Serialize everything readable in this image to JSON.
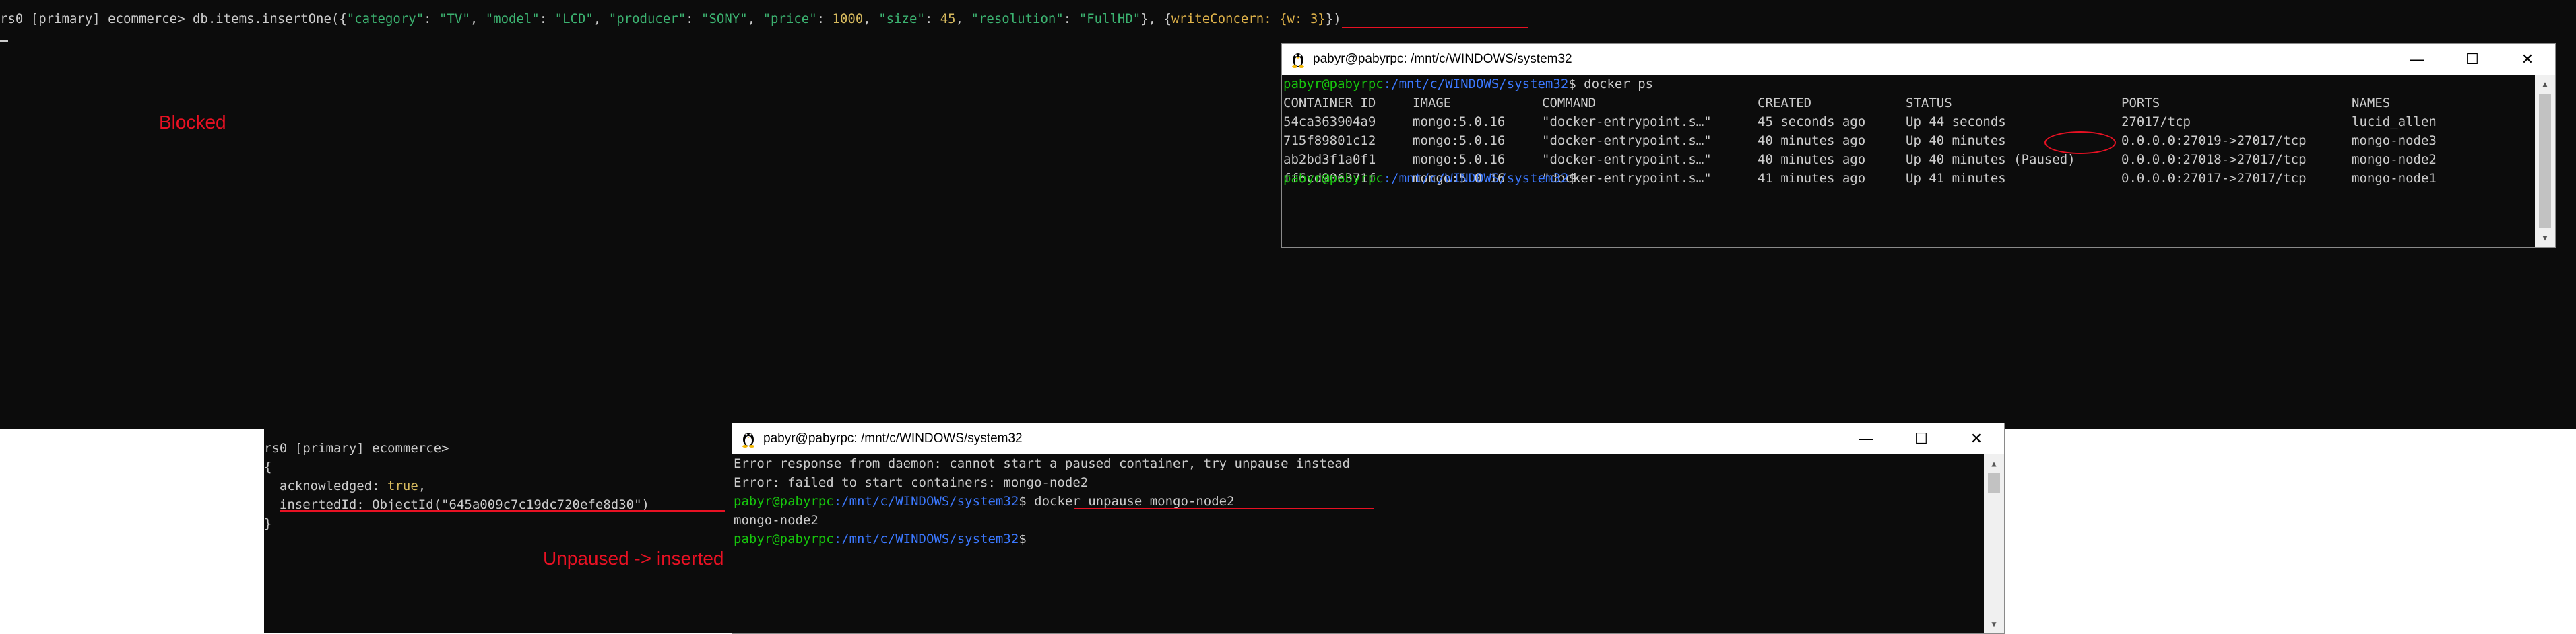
{
  "mongo_shell": {
    "prompt": "rs0 [primary] ecommerce>",
    "cmd_prefix": " db.items.insertOne({",
    "kv": [
      {
        "k": "\"category\"",
        "v": "\"TV\"",
        "num": false
      },
      {
        "k": "\"model\"",
        "v": "\"LCD\"",
        "num": false
      },
      {
        "k": "\"producer\"",
        "v": "\"SONY\"",
        "num": false
      },
      {
        "k": "\"price\"",
        "v": "1000",
        "num": true
      },
      {
        "k": "\"size\"",
        "v": "45",
        "num": true
      },
      {
        "k": "\"resolution\"",
        "v": "\"FullHD\"",
        "num": false
      }
    ],
    "cmd_mid": "}, {",
    "write_concern": "writeConcern: {w: 3}",
    "cmd_end": "})",
    "result_prompt": "rs0 [primary] ecommerce>",
    "result_lines": [
      "{",
      "  acknowledged: ",
      "true",
      ",",
      "  insertedId: ObjectId(\"645a009c7c19dc720efe8d30\")",
      "}"
    ]
  },
  "annotations": {
    "blocked": "Blocked",
    "unpaused": "Unpaused -> inserted"
  },
  "docker_ps_window": {
    "title": "pabyr@pabyrpc: /mnt/c/WINDOWS/system32",
    "prompt_user": "pabyr@pabyrpc",
    "prompt_path": ":/mnt/c/WINDOWS/system32",
    "command": "$ docker ps",
    "headers": [
      "CONTAINER ID",
      "IMAGE",
      "COMMAND",
      "CREATED",
      "STATUS",
      "PORTS",
      "NAMES"
    ],
    "rows": [
      [
        "54ca363904a9",
        "mongo:5.0.16",
        "\"docker-entrypoint.s…\"",
        "45 seconds ago",
        "Up 44 seconds",
        "27017/tcp",
        "lucid_allen"
      ],
      [
        "715f89801c12",
        "mongo:5.0.16",
        "\"docker-entrypoint.s…\"",
        "40 minutes ago",
        "Up 40 minutes",
        "0.0.0.0:27019->27017/tcp",
        "mongo-node3"
      ],
      [
        "ab2bd3f1a0f1",
        "mongo:5.0.16",
        "\"docker-entrypoint.s…\"",
        "40 minutes ago",
        "Up 40 minutes (Paused)",
        "0.0.0.0:27018->27017/tcp",
        "mongo-node2"
      ],
      [
        "ff6cd906371f",
        "mongo:5.0.16",
        "\"docker-entrypoint.s…\"",
        "41 minutes ago",
        "Up 41 minutes",
        "0.0.0.0:27017->27017/tcp",
        "mongo-node1"
      ]
    ],
    "end_prompt": "$"
  },
  "unpause_window": {
    "title": "pabyr@pabyrpc: /mnt/c/WINDOWS/system32",
    "lines": [
      "Error response from daemon: cannot start a paused container, try unpause instead",
      "Error: failed to start containers: mongo-node2"
    ],
    "prompt_user": "pabyr@pabyrpc",
    "prompt_path": ":/mnt/c/WINDOWS/system32",
    "command": "$ docker unpause mongo-node2",
    "output": "mongo-node2",
    "end_prompt": "$"
  },
  "window_controls": {
    "minimize": "—",
    "maximize": "☐",
    "close": "✕"
  },
  "icons": {
    "title_icon": "linux-penguin-icon"
  },
  "colors": {
    "terminal_bg": "#0c0c0c",
    "prompt_user": "#16c60c",
    "prompt_path": "#3b78ff",
    "annotation": "#e81123"
  }
}
